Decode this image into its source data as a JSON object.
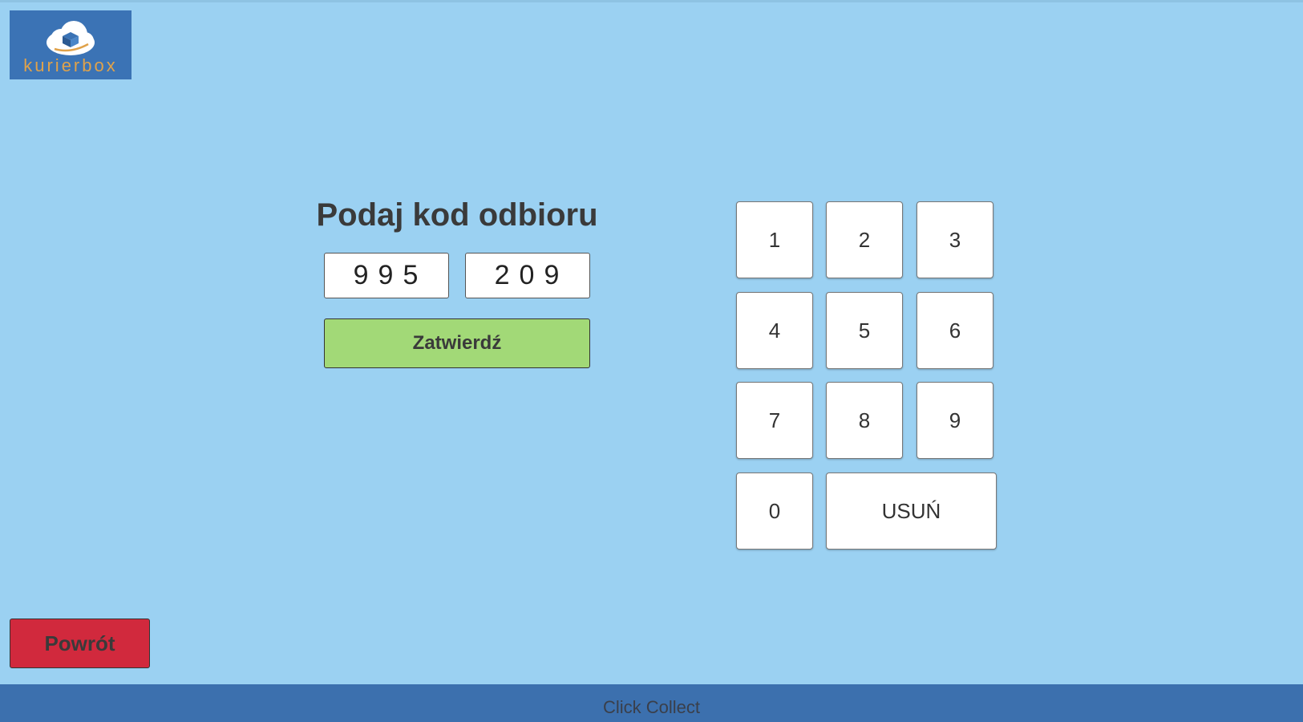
{
  "logo": {
    "text": "kurierbox",
    "icon": "cloud-box-icon"
  },
  "heading": "Podaj kod odbioru",
  "code": {
    "part1": "995",
    "part2": "209"
  },
  "confirm_label": "Zatwierdź",
  "keypad": {
    "k1": "1",
    "k2": "2",
    "k3": "3",
    "k4": "4",
    "k5": "5",
    "k6": "6",
    "k7": "7",
    "k8": "8",
    "k9": "9",
    "k0": "0",
    "delete": "USUŃ"
  },
  "back_label": "Powrót",
  "footer": "Click Collect",
  "colors": {
    "background": "#9bd1f2",
    "footer": "#3c70ae",
    "confirm": "#a2d977",
    "back": "#d1293d",
    "logo_bg": "#3b73b5",
    "logo_text": "#e0a24a"
  }
}
